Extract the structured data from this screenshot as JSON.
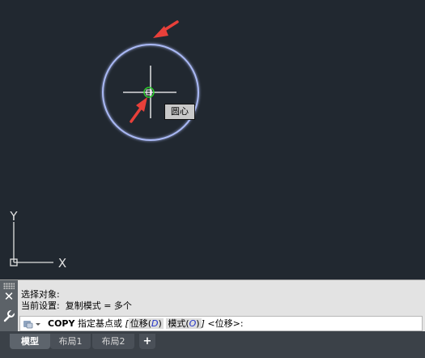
{
  "snap_tooltip": "圆心",
  "ucs": {
    "y_label": "Y",
    "x_label": "X"
  },
  "command_history": [
    "选择对象:",
    "当前设置:  复制模式 = 多个"
  ],
  "command_line": {
    "name": "COPY",
    "prompt": "指定基点或",
    "bracket_open": "[",
    "options": [
      {
        "label": "位移(",
        "key": "D",
        "close": ")"
      },
      {
        "label": "模式(",
        "key": "O",
        "close": ")"
      }
    ],
    "bracket_close": "]",
    "default": "<位移>:"
  },
  "tabs": {
    "model": "模型",
    "layout1": "布局1",
    "layout2": "布局2",
    "add": "+"
  },
  "colors": {
    "canvas_bg": "#212830",
    "circle": "#a9b8f4",
    "crosshair": "#ffffff",
    "snap_marker": "#2ad12a",
    "arrow": "#e8403a"
  }
}
